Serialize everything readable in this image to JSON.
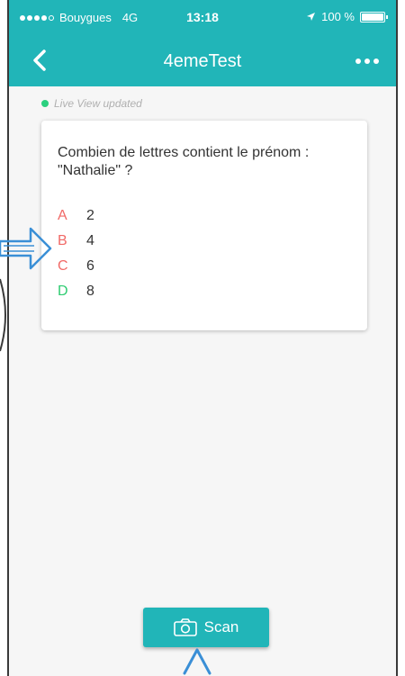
{
  "status_bar": {
    "carrier": "Bouygues",
    "network": "4G",
    "time": "13:18",
    "battery_text": "100 %",
    "battery_level": 1.0
  },
  "nav": {
    "title": "4emeTest"
  },
  "live_status": {
    "text": "Live View updated"
  },
  "question": {
    "text": "Combien de lettres contient le prénom : \"Nathalie\" ?",
    "answers": [
      {
        "letter": "A",
        "value": "2",
        "color": "#f16a67"
      },
      {
        "letter": "B",
        "value": "4",
        "color": "#f16a67"
      },
      {
        "letter": "C",
        "value": "6",
        "color": "#f16a67"
      },
      {
        "letter": "D",
        "value": "8",
        "color": "#2ecc71"
      }
    ]
  },
  "scan": {
    "label": "Scan"
  },
  "colors": {
    "brand": "#21b5b8",
    "live": "#2bd07f",
    "wrong": "#f16a67",
    "correct": "#2ecc71",
    "annotation": "#3a8fd6"
  }
}
